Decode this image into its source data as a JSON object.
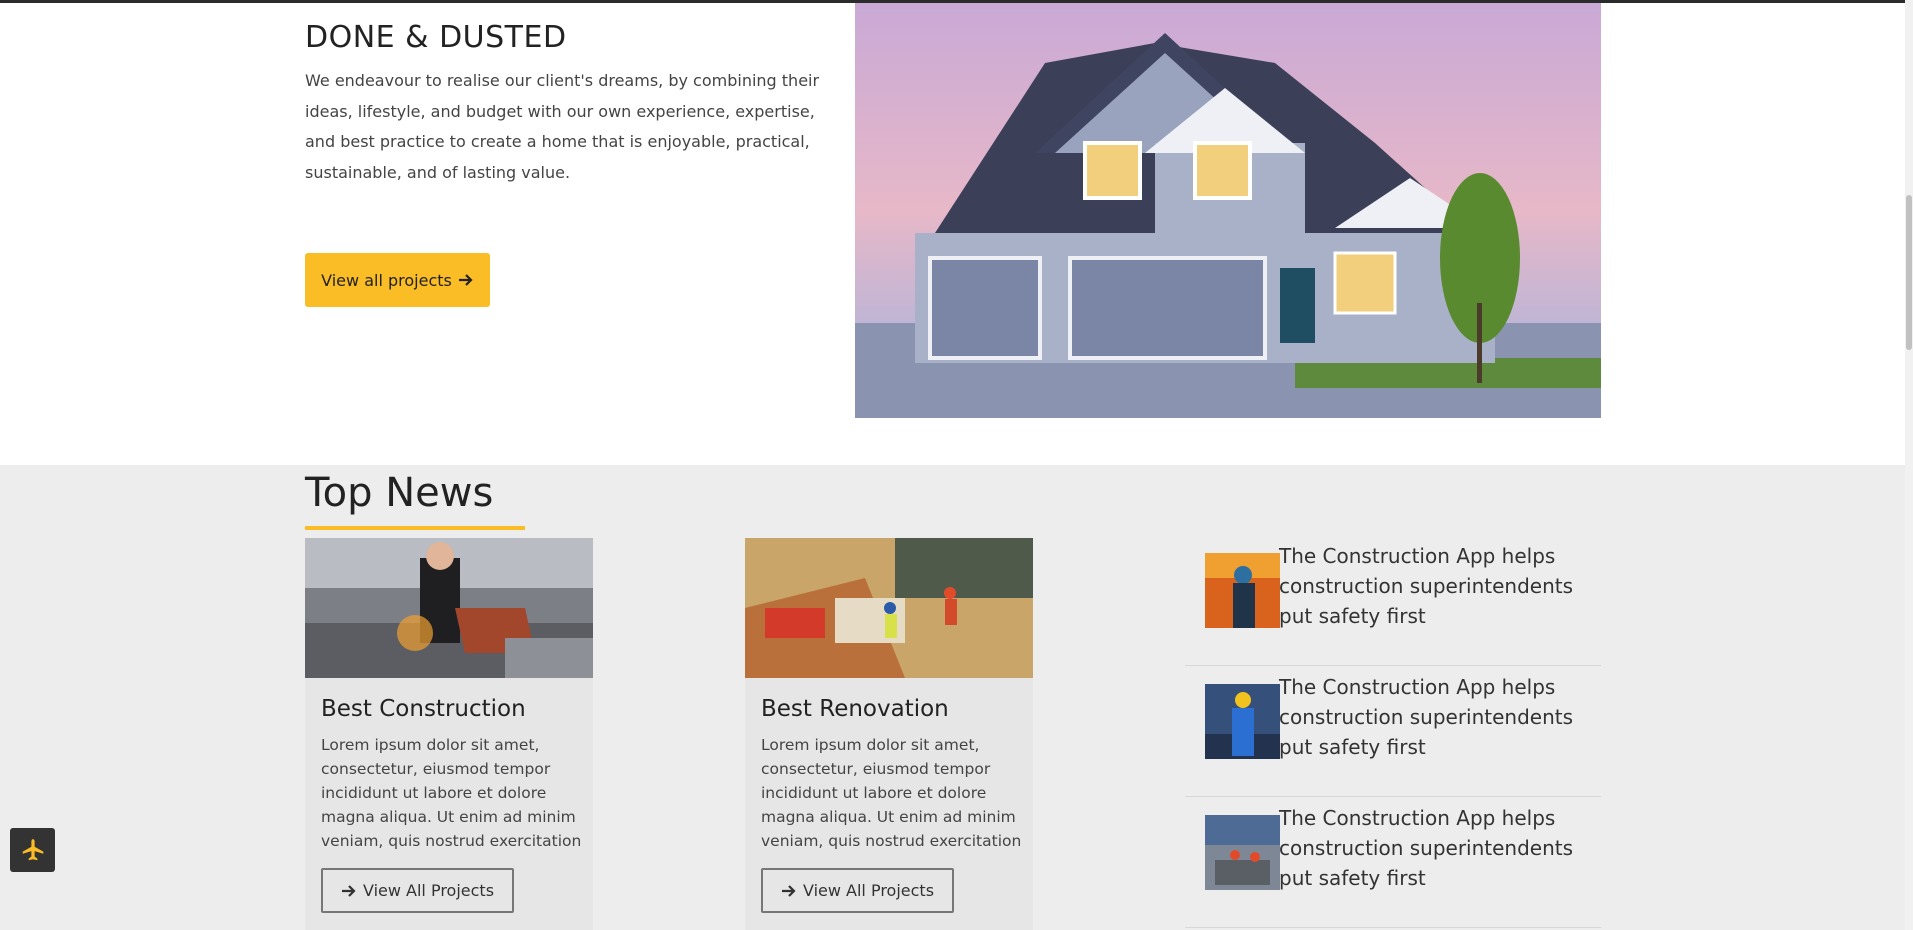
{
  "hero": {
    "title": "DONE & DUSTED",
    "text": "We endeavour to realise our client's dreams, by combining their ideas, lifestyle, and budget with our own experience, expertise, and best practice to create a home that is enjoyable, practical, sustainable, and of lasting value.",
    "button_label": "View all projects",
    "button_icon": "arrow-right-icon",
    "image_icon": "house-photo"
  },
  "news": {
    "title": "Top News",
    "cards": [
      {
        "title": "Best Construction",
        "text": "Lorem ipsum dolor sit amet, consectetur, eiusmod tempor incididunt ut labore et dolore magna aliqua. Ut enim ad minim veniam, quis nostrud exercitation",
        "button_label": "View All Projects",
        "image_icon": "welder-photo"
      },
      {
        "title": "Best Renovation",
        "text": "Lorem ipsum dolor sit amet, consectetur, eiusmod tempor incididunt ut labore et dolore magna aliqua. Ut enim ad minim veniam, quis nostrud exercitation",
        "button_label": "View All Projects",
        "image_icon": "construction-site-photo"
      }
    ],
    "side_items": [
      {
        "text": "The Construction App helps construction superintendents put safety first",
        "image_icon": "worker-photo"
      },
      {
        "text": "The Construction App helps construction superintendents put safety first",
        "image_icon": "worker-photo"
      },
      {
        "text": "The Construction App helps construction superintendents put safety first",
        "image_icon": "worker-photo"
      }
    ]
  },
  "floating_button": {
    "icon": "plane-icon"
  },
  "colors": {
    "accent": "#fbbd26",
    "section_bg": "#ededed",
    "text": "#222222"
  }
}
